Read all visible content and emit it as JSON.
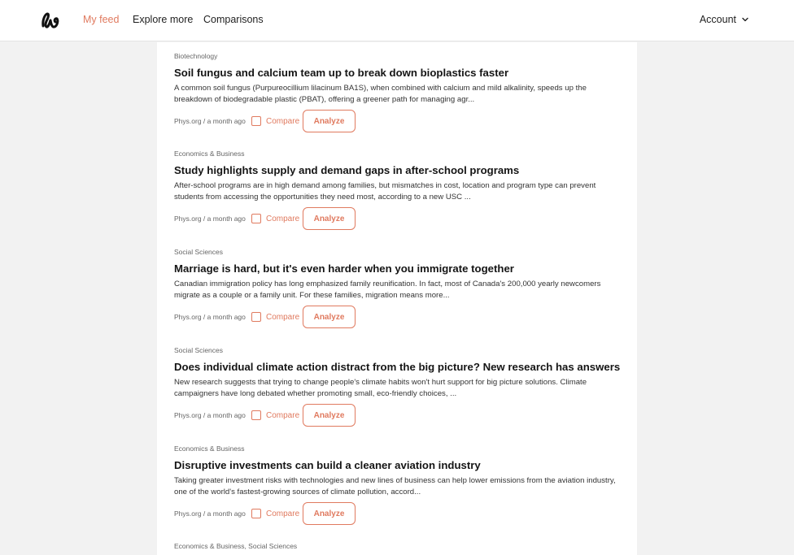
{
  "nav": {
    "links": [
      "My feed",
      "Explore more",
      "Comparisons"
    ],
    "active": "My feed",
    "account_label": "Account"
  },
  "colors": {
    "accent": "#e07a5f",
    "background": "#f2f2f2"
  },
  "icons": {
    "logo": "brand-logo-icon",
    "account_dropdown": "chevron-down-icon"
  },
  "feed": {
    "compare_label": "Compare",
    "analyze_label": "Analyze",
    "articles": [
      {
        "category": "Biotechnology",
        "title": "Soil fungus and calcium team up to break down bioplastics faster",
        "summary": "A common soil fungus (Purpureocillium lilacinum BA1S), when combined with calcium and mild alkalinity, speeds up the breakdown of biodegradable plastic (PBAT), offering a greener path for managing agr...",
        "source": "Phys.org / a month ago"
      },
      {
        "category": "Economics & Business",
        "title": "Study highlights supply and demand gaps in after-school programs",
        "summary": "After-school programs are in high demand among families, but mismatches in cost, location and program type can prevent students from accessing the opportunities they need most, according to a new USC ...",
        "source": "Phys.org / a month ago"
      },
      {
        "category": "Social Sciences",
        "title": "Marriage is hard, but it's even harder when you immigrate together",
        "summary": "Canadian immigration policy has long emphasized family reunification. In fact, most of Canada's 200,000 yearly newcomers migrate as a couple or a family unit. For these families, migration means more...",
        "source": "Phys.org / a month ago"
      },
      {
        "category": "Social Sciences",
        "title": "Does individual climate action distract from the big picture? New research has answers",
        "summary": "New research suggests that trying to change people's climate habits won't hurt support for big picture solutions. Climate campaigners have long debated whether promoting small, eco-friendly choices, ...",
        "source": "Phys.org / a month ago"
      },
      {
        "category": "Economics & Business",
        "title": "Disruptive investments can build a cleaner aviation industry",
        "summary": "Taking greater investment risks with technologies and new lines of business can help lower emissions from the aviation industry, one of the world's fastest-growing sources of climate pollution, accord...",
        "source": "Phys.org / a month ago"
      },
      {
        "category": "Economics & Business, Social Sciences"
      }
    ]
  }
}
